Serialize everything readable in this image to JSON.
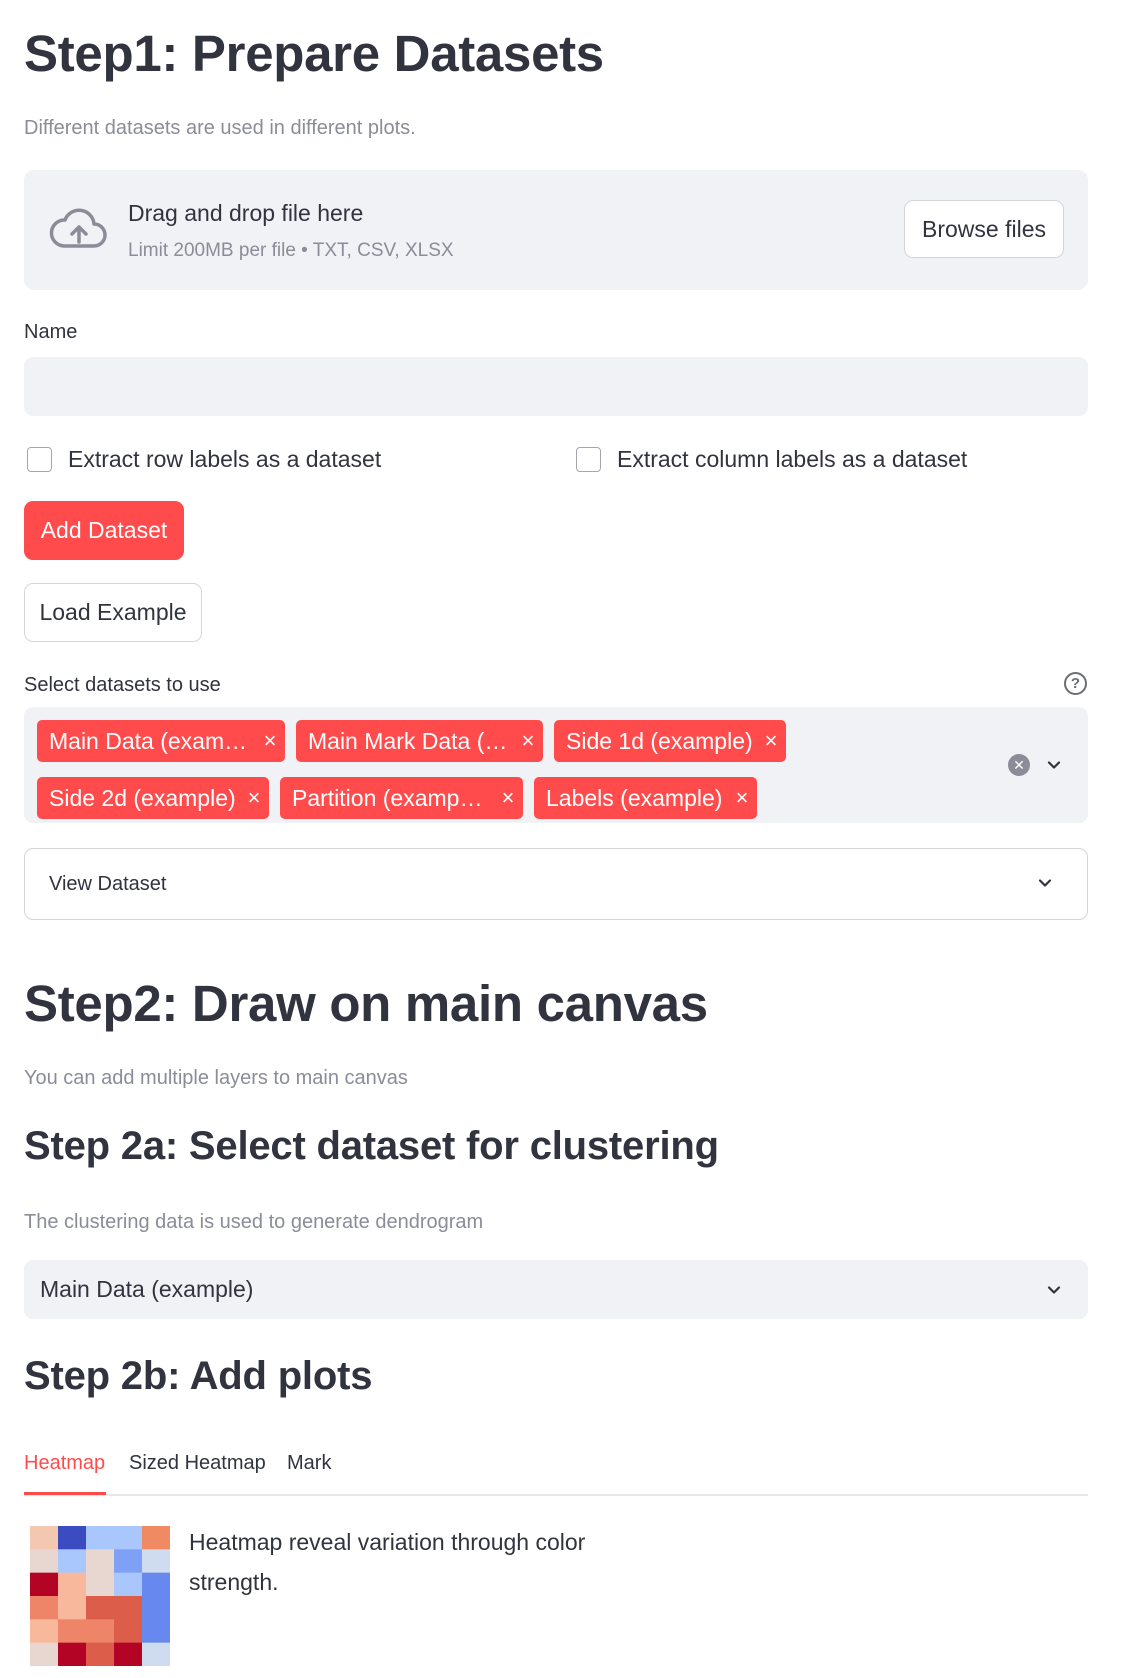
{
  "step1": {
    "title": "Step1: Prepare Datasets",
    "caption": "Different datasets are used in different plots."
  },
  "uploader": {
    "title": "Drag and drop file here",
    "limit": "Limit 200MB per file • TXT, CSV, XLSX",
    "browse_label": "Browse files",
    "icon": "cloud-upload-icon"
  },
  "name_field": {
    "label": "Name",
    "value": "",
    "placeholder": ""
  },
  "checkboxes": {
    "row_labels": {
      "label": "Extract row labels as a dataset",
      "checked": false
    },
    "col_labels": {
      "label": "Extract column labels as a dataset",
      "checked": false
    }
  },
  "buttons": {
    "add_dataset": "Add Dataset",
    "load_example": "Load Example"
  },
  "dataset_select": {
    "label": "Select datasets to use",
    "help_icon": "question-circle-icon",
    "tags": [
      "Main Data (exam…",
      "Main Mark Data (…",
      "Side 1d (example)",
      "Side 2d (example)",
      "Partition (examp…",
      "Labels (example)"
    ],
    "tag_remove_glyph": "×"
  },
  "view_dataset": {
    "label": "View Dataset"
  },
  "step2": {
    "title": "Step2: Draw on main canvas",
    "caption": "You can add multiple layers to main canvas"
  },
  "step2a": {
    "title": "Step 2a: Select dataset for clustering",
    "caption": "The clustering data is used to generate dendrogram",
    "selected": "Main Data (example)"
  },
  "step2b": {
    "title": "Step 2b: Add plots",
    "tabs": [
      "Heatmap",
      "Sized Heatmap",
      "Mark"
    ],
    "active_tab": 0,
    "heatmap_description": "Heatmap reveal variation through color strength.",
    "heatmap_colors": [
      [
        "#f4c7b0",
        "#3b4cc0",
        "#aac7fd",
        "#aac7fd",
        "#ef8a62"
      ],
      [
        "#e7d7d0",
        "#aac7fd",
        "#e7d7d0",
        "#7ea1f5",
        "#cfdbef"
      ],
      [
        "#b40426",
        "#f7b89c",
        "#e7d7d0",
        "#aac7fd",
        "#6788ee"
      ],
      [
        "#ee8468",
        "#f7b89c",
        "#dc5d4a",
        "#dc5d4a",
        "#6788ee"
      ],
      [
        "#f7b89c",
        "#ee8468",
        "#ee8468",
        "#dc5d4a",
        "#6788ee"
      ],
      [
        "#e7d7d0",
        "#b40426",
        "#dc5d4a",
        "#b40426",
        "#cfdbef"
      ]
    ]
  },
  "colors": {
    "primary": "#ff4b4b",
    "text": "#31333f",
    "muted": "#8a8d97",
    "input_bg": "#f0f2f6"
  }
}
